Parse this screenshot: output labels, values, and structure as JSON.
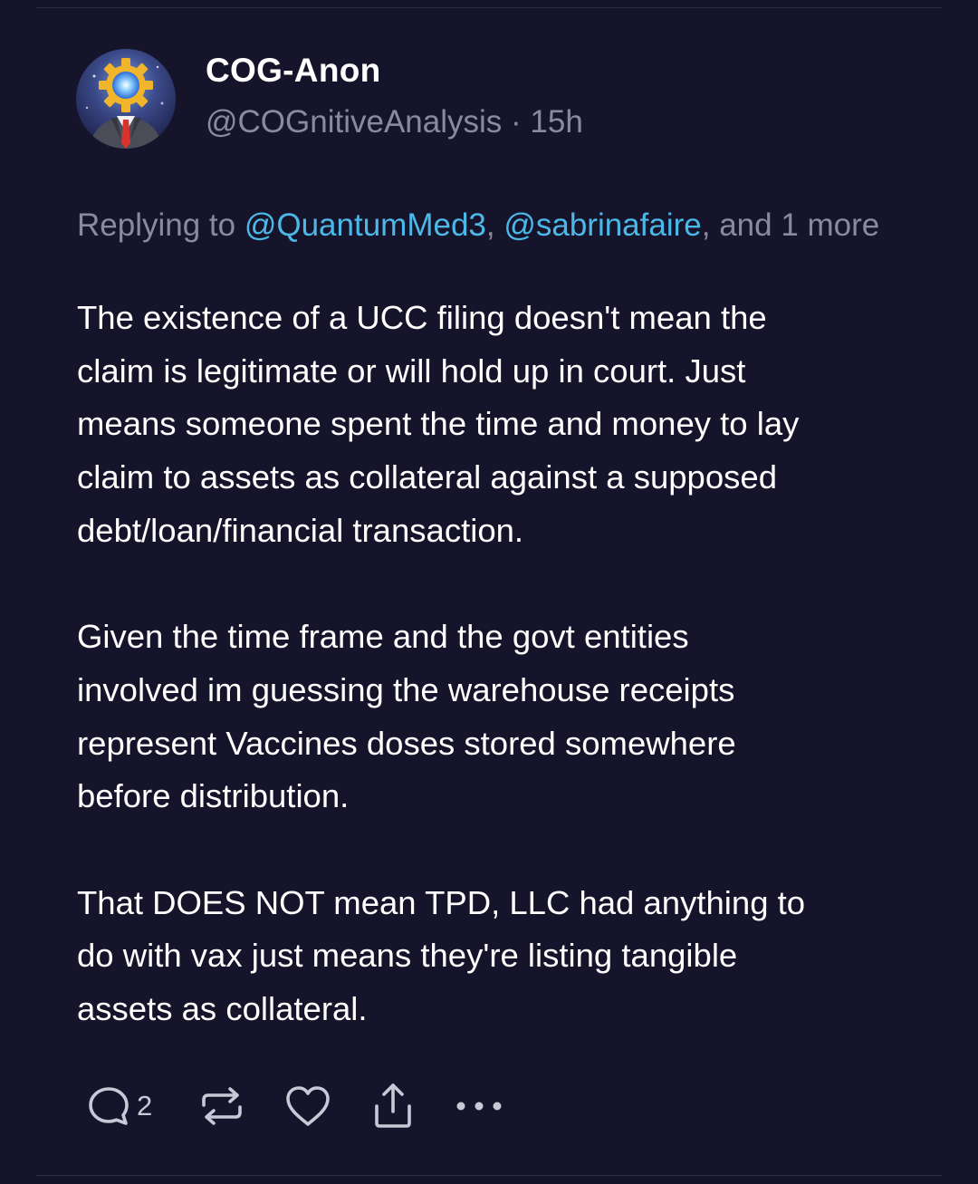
{
  "post": {
    "author": {
      "display_name": "COG-Anon",
      "handle": "@COGnitiveAnalysis",
      "separator": " · ",
      "time": "15h"
    },
    "reply": {
      "prefix": "Replying to ",
      "mention_1": "@QuantumMed3",
      "comma": ", ",
      "mention_2": "@sabrinafaire",
      "suffix": ", and 1 more"
    },
    "paragraphs": [
      "The existence of a UCC filing doesn't mean the\nclaim is legitimate or will hold up in court. Just\nmeans someone spent the time and money to lay\nclaim to assets as collateral against a supposed\ndebt/loan/financial transaction.",
      "Given the time frame and the govt entities\ninvolved im guessing the warehouse receipts\nrepresent Vaccines doses stored somewhere\nbefore distribution.",
      "That DOES NOT mean TPD, LLC had anything to\ndo with vax just means they're listing tangible\nassets as collateral."
    ],
    "actions": {
      "reply_count": "2",
      "reply_icon": "comment-bubble-icon",
      "repost_icon": "repost-arrows-icon",
      "like_icon": "heart-icon",
      "share_icon": "share-upload-icon",
      "more_icon": "ellipsis-icon"
    }
  },
  "colors": {
    "background": "#16142b",
    "text": "#ffffff",
    "muted": "#8b8a9c",
    "link": "#4cb8e8",
    "icon": "#c9c8d6"
  }
}
